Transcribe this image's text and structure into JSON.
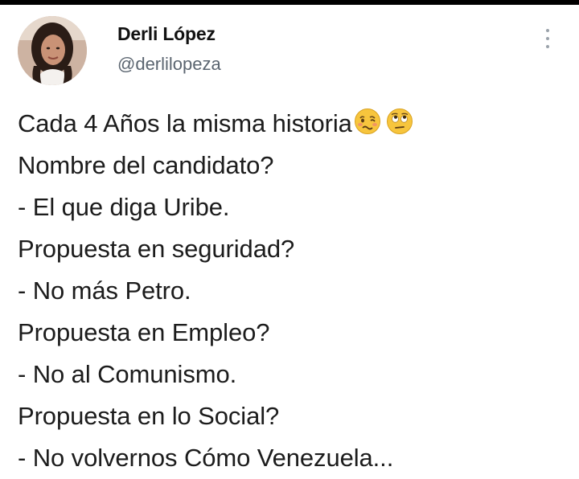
{
  "author": {
    "display_name": "Derli López",
    "handle": "@derlilopeza"
  },
  "tweet": {
    "first_line": "Cada 4 Años la misma historia",
    "emojis": [
      "woozy-face-icon",
      "face-with-rolling-eyes-icon"
    ],
    "lines": [
      "Nombre del candidato?",
      "- El que diga Uribe.",
      "Propuesta en seguridad?",
      "- No más Petro.",
      "Propuesta en Empleo?",
      "- No al Comunismo.",
      "Propuesta en lo Social?",
      "- No volvernos Cómo Venezuela..."
    ]
  },
  "colors": {
    "text": "#1c1c1c",
    "handle": "#5b6570",
    "emoji_yellow": "#f7c53d",
    "top_bar": "#000000"
  }
}
